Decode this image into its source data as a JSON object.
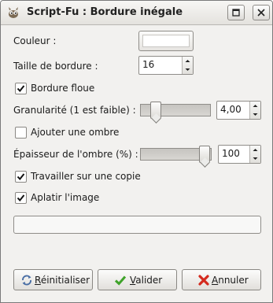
{
  "window": {
    "title": "Script-Fu : Bordure inégale"
  },
  "fields": {
    "couleur_label": "Couleur :",
    "taille_label": "Taille de bordure :",
    "taille_value": "16",
    "bordure_floue_label": "Bordure floue",
    "bordure_floue_checked": true,
    "granularite_label": "Granularité (1 est faible) :",
    "granularite_value": "4,00",
    "ajouter_ombre_label": "Ajouter une ombre",
    "ajouter_ombre_checked": false,
    "epaisseur_label": "Épaisseur de l'ombre (%) :",
    "epaisseur_value": "100",
    "copie_label": "Travailler sur une copie",
    "copie_checked": true,
    "aplatir_label": "Aplatir l'image",
    "aplatir_checked": true,
    "color_value": "#ffffff"
  },
  "buttons": {
    "reset_mnemonic": "R",
    "reset_rest": "éinitialiser",
    "ok_mnemonic": "V",
    "ok_rest": "alider",
    "cancel_mnemonic": "A",
    "cancel_rest": "nnuler"
  },
  "icons": {
    "app": "gimp-wilber-icon",
    "maximize": "maximize-icon",
    "close": "close-icon",
    "reset": "refresh-icon",
    "ok": "checkmark-icon",
    "cancel": "cancel-x-icon"
  },
  "colors": {
    "ok_green": "#3fa32a",
    "cancel_red": "#d42a1e"
  }
}
